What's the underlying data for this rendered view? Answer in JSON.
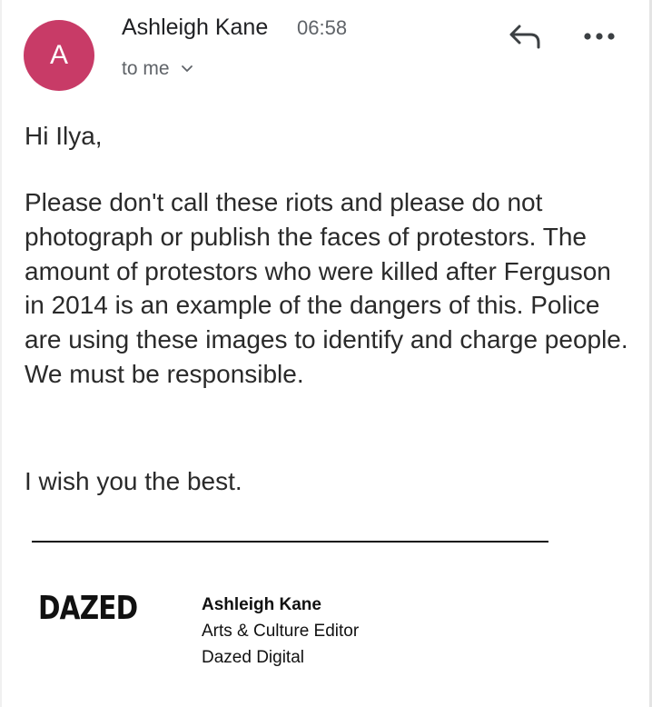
{
  "sender": {
    "avatar_initial": "A",
    "avatar_color": "#c83b67",
    "name": "Ashleigh Kane",
    "time": "06:58",
    "recipient_label": "to me"
  },
  "actions": {
    "reply_icon": "reply-icon",
    "more_icon": "more-horizontal-icon"
  },
  "message": {
    "greeting": "Hi Ilya,",
    "paragraph": "Please don't call these riots and please do not photograph or publish the faces of protestors. The amount of protestors who were killed after Ferguson in 2014 is an example of the dangers of this. Police are using these images to identify and charge people. We must be responsible.",
    "closing": "I wish you the best."
  },
  "signature": {
    "logo_text": "DAZED",
    "name": "Ashleigh Kane",
    "title": "Arts & Culture Editor",
    "company": "Dazed Digital"
  }
}
